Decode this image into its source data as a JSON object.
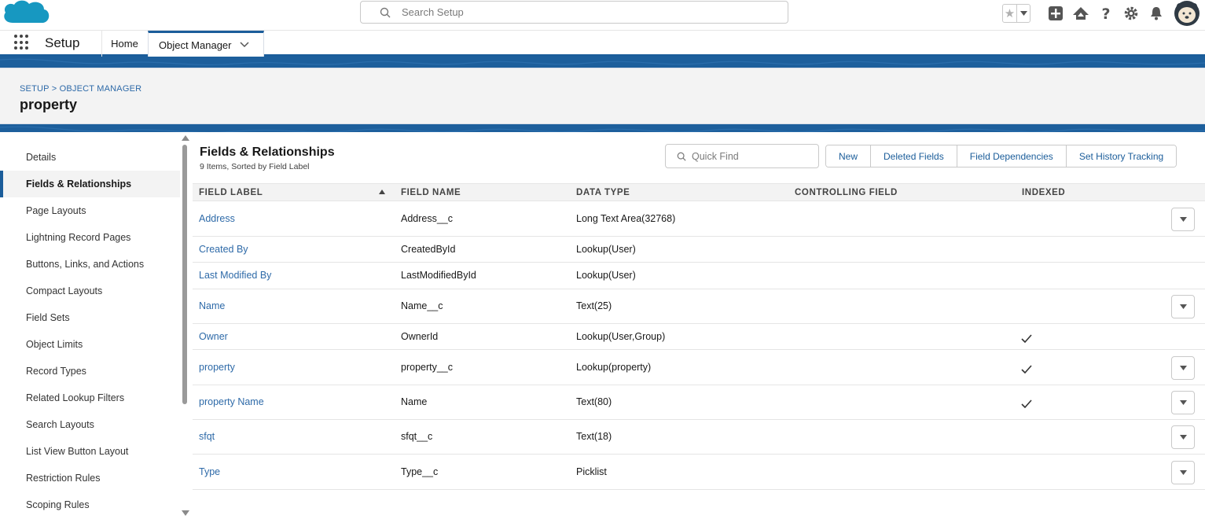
{
  "global": {
    "search_placeholder": "Search Setup"
  },
  "app_nav": {
    "app_name": "Setup",
    "tabs": [
      {
        "label": "Home"
      },
      {
        "label": "Object Manager"
      }
    ]
  },
  "page_header": {
    "breadcrumb": "SETUP > OBJECT MANAGER",
    "title": "property"
  },
  "sidebar": {
    "items": [
      {
        "label": "Details"
      },
      {
        "label": "Fields & Relationships"
      },
      {
        "label": "Page Layouts"
      },
      {
        "label": "Lightning Record Pages"
      },
      {
        "label": "Buttons, Links, and Actions"
      },
      {
        "label": "Compact Layouts"
      },
      {
        "label": "Field Sets"
      },
      {
        "label": "Object Limits"
      },
      {
        "label": "Record Types"
      },
      {
        "label": "Related Lookup Filters"
      },
      {
        "label": "Search Layouts"
      },
      {
        "label": "List View Button Layout"
      },
      {
        "label": "Restriction Rules"
      },
      {
        "label": "Scoping Rules"
      }
    ],
    "active_index": 1
  },
  "content": {
    "title": "Fields & Relationships",
    "subtitle": "9 Items, Sorted by Field Label",
    "quick_find_placeholder": "Quick Find",
    "buttons": {
      "new": "New",
      "deleted_fields": "Deleted Fields",
      "field_dependencies": "Field Dependencies",
      "set_history_tracking": "Set History Tracking"
    },
    "columns": {
      "field_label": "FIELD LABEL",
      "field_name": "FIELD NAME",
      "data_type": "DATA TYPE",
      "controlling_field": "CONTROLLING FIELD",
      "indexed": "INDEXED"
    },
    "rows": [
      {
        "label": "Address",
        "name": "Address__c",
        "type": "Long Text Area(32768)",
        "indexed": false,
        "menu": true
      },
      {
        "label": "Created By",
        "name": "CreatedById",
        "type": "Lookup(User)",
        "indexed": false,
        "menu": false
      },
      {
        "label": "Last Modified By",
        "name": "LastModifiedById",
        "type": "Lookup(User)",
        "indexed": false,
        "menu": false
      },
      {
        "label": "Name",
        "name": "Name__c",
        "type": "Text(25)",
        "indexed": false,
        "menu": true
      },
      {
        "label": "Owner",
        "name": "OwnerId",
        "type": "Lookup(User,Group)",
        "indexed": true,
        "menu": false
      },
      {
        "label": "property",
        "name": "property__c",
        "type": "Lookup(property)",
        "indexed": true,
        "menu": true
      },
      {
        "label": "property Name",
        "name": "Name",
        "type": "Text(80)",
        "indexed": true,
        "menu": true
      },
      {
        "label": "sfqt",
        "name": "sfqt__c",
        "type": "Text(18)",
        "indexed": false,
        "menu": true
      },
      {
        "label": "Type",
        "name": "Type__c",
        "type": "Picklist",
        "indexed": false,
        "menu": true
      }
    ]
  },
  "colors": {
    "brand_blue": "#1b5d9a",
    "link_blue": "#2e6aa8",
    "salesforce_cloud": "#1798c1"
  }
}
